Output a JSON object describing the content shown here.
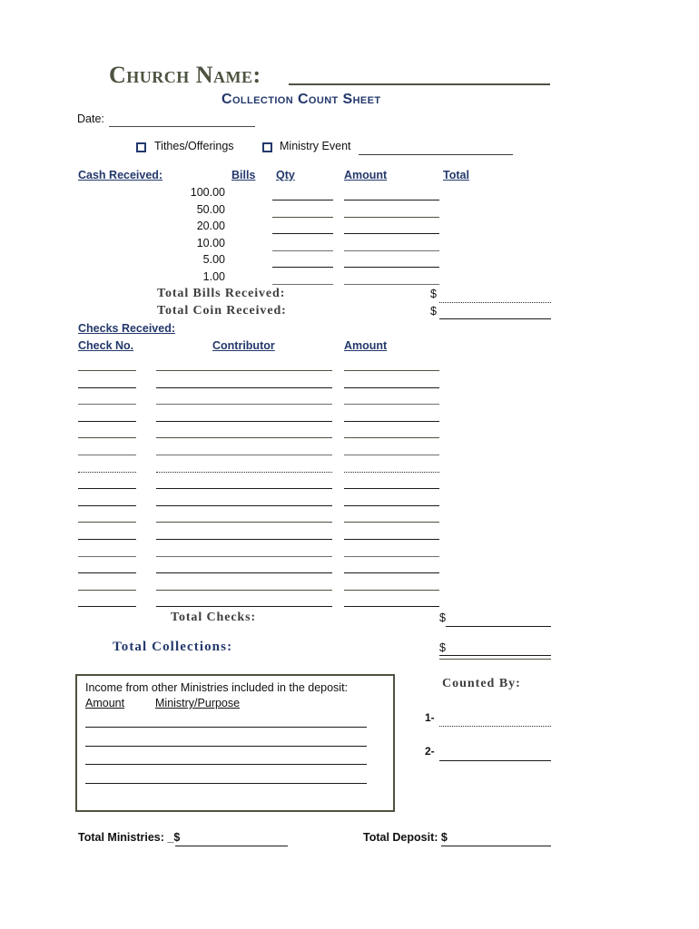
{
  "header": {
    "church_name_label": "Church Name:",
    "subtitle": "Collection Count Sheet",
    "date_label": "Date:"
  },
  "collection_type": {
    "tithes_label": "Tithes/Offerings",
    "ministry_event_label": "Ministry Event"
  },
  "cash_section": {
    "title": "Cash Received:",
    "columns": {
      "bills": "Bills",
      "qty": "Qty",
      "amount": "Amount",
      "total": "Total"
    },
    "denominations": [
      "100.00",
      "50.00",
      "20.00",
      "10.00",
      "5.00",
      "1.00"
    ],
    "total_bills_label": "Total Bills Received:",
    "total_coin_label": "Total Coin Received:",
    "currency_symbol": "$"
  },
  "checks_section": {
    "title": "Checks Received:",
    "columns": {
      "check_no": "Check No.",
      "contributor": "Contributor",
      "amount": "Amount"
    },
    "row_count": 15,
    "total_checks_label": "Total Checks:",
    "currency_symbol": "$"
  },
  "totals": {
    "total_collections_label": "Total Collections:",
    "currency_symbol": "$"
  },
  "ministries_box": {
    "title": "Income from other Ministries included in the deposit:",
    "amount_header": "Amount",
    "purpose_header": "Ministry/Purpose",
    "line_count": 4
  },
  "counted_by": {
    "title": "Counted By:",
    "entries": [
      "1-",
      "2-"
    ]
  },
  "footer": {
    "total_ministries_label": "Total Ministries:  _$",
    "total_deposit_label": "Total Deposit: $"
  },
  "colors": {
    "olive": "#4c5340",
    "navy": "#23386b",
    "gray_serif": "#3d3d3d",
    "black": "#1a1a1a"
  }
}
